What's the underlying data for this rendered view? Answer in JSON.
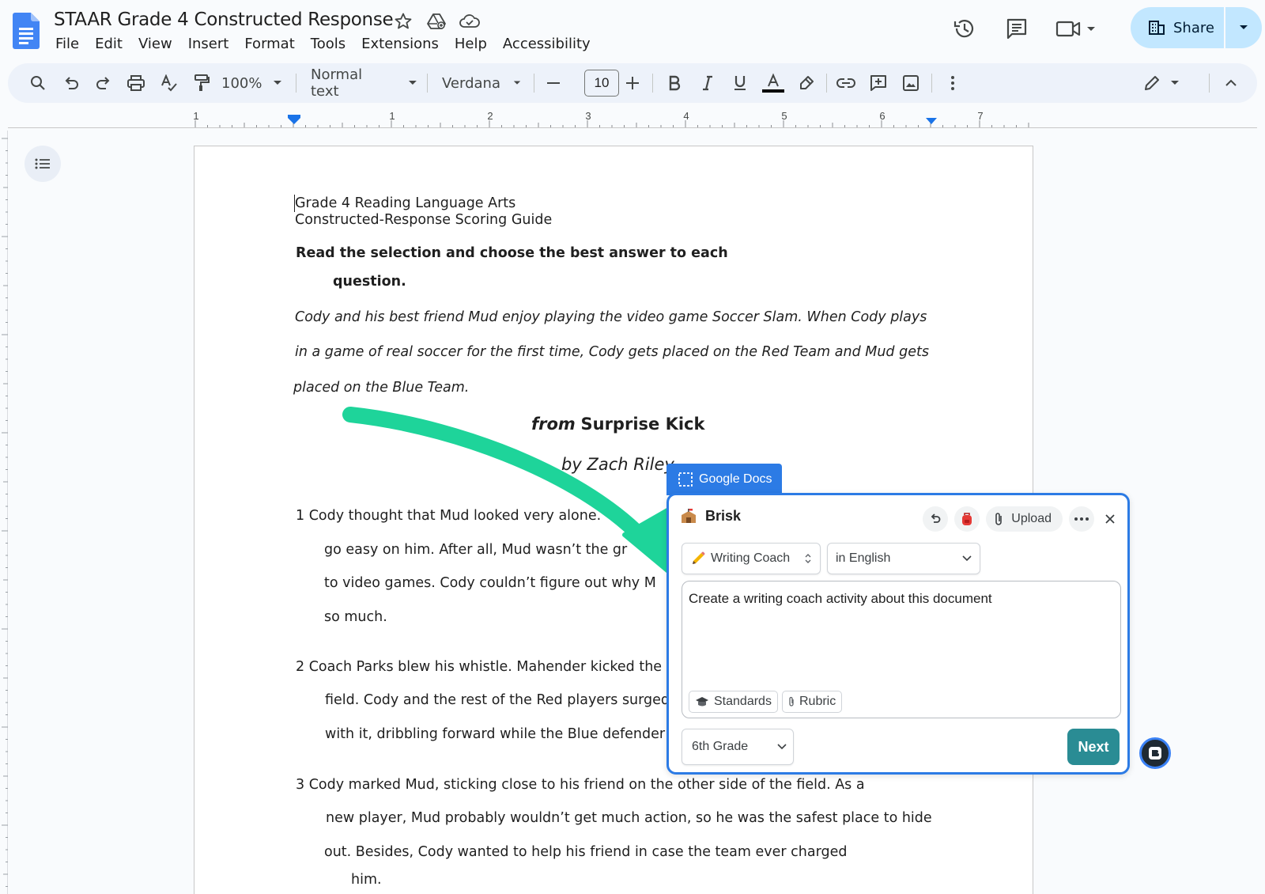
{
  "app": {
    "doc_title": "STAAR Grade 4 Constructed Response",
    "menu": [
      "File",
      "Edit",
      "View",
      "Insert",
      "Format",
      "Tools",
      "Extensions",
      "Help",
      "Accessibility"
    ],
    "share_label": "Share"
  },
  "toolbar": {
    "zoom": "100%",
    "style": "Normal text",
    "font": "Verdana",
    "font_size": "10"
  },
  "ruler": {
    "labels": [
      "1",
      "1",
      "2",
      "3",
      "4",
      "5",
      "6",
      "7"
    ]
  },
  "document": {
    "header1": "Grade 4 Reading Language Arts",
    "header2": "Constructed-Response Scoring Guide",
    "instruction1": "Read the selection and choose the best answer to each",
    "instruction2": "question.",
    "intro1": "Cody and his best friend Mud enjoy playing the video game Soccer Slam. When Cody plays",
    "intro2": "in a game of real soccer for the first time, Cody gets placed on the Red Team and Mud gets",
    "intro3": "placed on the Blue Team.",
    "title_from": "from",
    "title_main": "Surprise Kick",
    "byline": "by Zach Riley",
    "p1": [
      "1 Cody thought that Mud looked very alone. “th",
      "go easy on him. After all, Mud wasn’t the gr",
      "to video games. Cody couldn’t figure out why M",
      "so much."
    ],
    "p2": [
      "2 Coach Parks blew his whistle. Mahender kicked the",
      "field. Cody and the rest of the Red players surged",
      "with it, dribbling forward while the Blue defender"
    ],
    "p3": [
      "3 Cody marked Mud, sticking close to his friend on the other side of the field. As a",
      "new player, Mud probably wouldn’t get much action, so he was the safest place to hide",
      "out. Besides, Cody wanted to help his friend in case the team ever charged",
      "him."
    ]
  },
  "brisk": {
    "context_tab": "Google Docs",
    "title": "Brisk",
    "upload_label": "Upload",
    "tool": "Writing Coach",
    "language": "in English",
    "prompt": "Create a writing coach activity about this document",
    "chips": [
      "Standards",
      "Rubric"
    ],
    "grade": "6th Grade",
    "next_label": "Next"
  },
  "colors": {
    "accent_blue": "#2c7be5",
    "share_bg": "#c2e7ff",
    "next_bg": "#2a8c94",
    "arrow_green": "#1ed49a"
  }
}
